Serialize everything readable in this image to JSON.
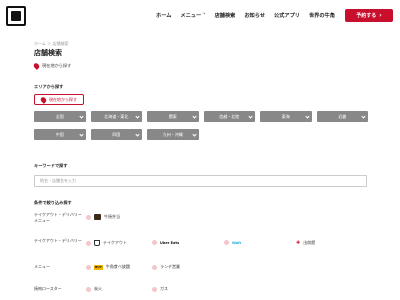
{
  "header": {
    "nav": [
      "ホーム",
      "メニュー",
      "店舗検索",
      "お知らせ",
      "公式アプリ",
      "世界の牛角"
    ],
    "reserve_label": "予約する"
  },
  "breadcrumb": [
    "ホーム",
    "店舗検索"
  ],
  "page_title": "店舗検索",
  "near_link": "現在地から探す",
  "area": {
    "label": "エリアから探す",
    "current_btn": "現在地から探す",
    "regions": [
      "全国",
      "北海道・東北",
      "関東",
      "信越・北陸",
      "東海",
      "近畿",
      "中国",
      "四国",
      "九州・沖縄"
    ]
  },
  "keyword": {
    "label": "キーワードで探す",
    "placeholder": "地名・店舗名を入力"
  },
  "conditions": {
    "label": "条件で絞り込み探す",
    "rows": [
      {
        "label": "テイクアウト・デリバリーメニュー",
        "options": [
          "牛焼弁当"
        ]
      },
      {
        "label": "テイクアウト・デリバリー",
        "options": [
          "テイクアウト",
          "Uber Eats",
          "Wolt",
          "出前館"
        ]
      },
      {
        "label": "メニュー",
        "options": [
          "牛角食べ放題",
          "ランチ営業"
        ]
      },
      {
        "label": "焼肉ロースター",
        "options": [
          "炭火",
          "ガス"
        ]
      }
    ]
  },
  "colors": {
    "accent": "#c8102e",
    "area_button": "#888888"
  }
}
